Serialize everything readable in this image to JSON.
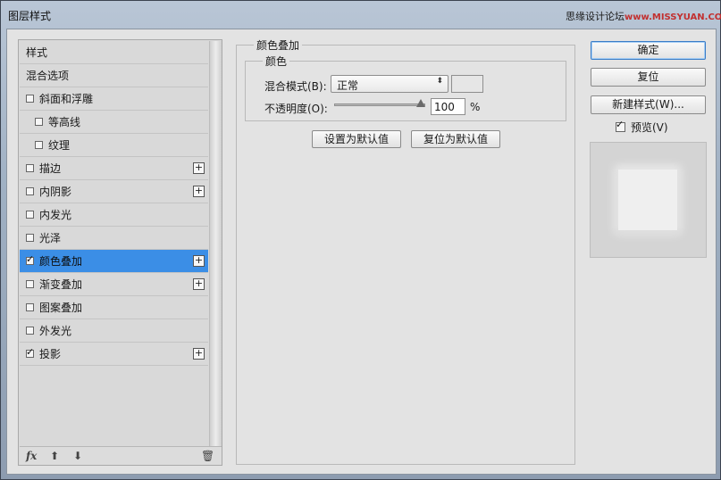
{
  "window": {
    "title": "图层样式",
    "watermark_prefix": "思缘设计论坛",
    "watermark_site": "www.MISSYUAN.COM"
  },
  "styles": {
    "items": [
      {
        "label": "样式",
        "checkbox": false,
        "checked": false,
        "plus": false,
        "indent": false,
        "selected": false
      },
      {
        "label": "混合选项",
        "checkbox": false,
        "checked": false,
        "plus": false,
        "indent": false,
        "selected": false
      },
      {
        "label": "斜面和浮雕",
        "checkbox": true,
        "checked": false,
        "plus": false,
        "indent": false,
        "selected": false
      },
      {
        "label": "等高线",
        "checkbox": true,
        "checked": false,
        "plus": false,
        "indent": true,
        "selected": false
      },
      {
        "label": "纹理",
        "checkbox": true,
        "checked": false,
        "plus": false,
        "indent": true,
        "selected": false
      },
      {
        "label": "描边",
        "checkbox": true,
        "checked": false,
        "plus": true,
        "indent": false,
        "selected": false
      },
      {
        "label": "内阴影",
        "checkbox": true,
        "checked": false,
        "plus": true,
        "indent": false,
        "selected": false
      },
      {
        "label": "内发光",
        "checkbox": true,
        "checked": false,
        "plus": false,
        "indent": false,
        "selected": false
      },
      {
        "label": "光泽",
        "checkbox": true,
        "checked": false,
        "plus": false,
        "indent": false,
        "selected": false
      },
      {
        "label": "颜色叠加",
        "checkbox": true,
        "checked": true,
        "plus": true,
        "indent": false,
        "selected": true
      },
      {
        "label": "渐变叠加",
        "checkbox": true,
        "checked": false,
        "plus": true,
        "indent": false,
        "selected": false
      },
      {
        "label": "图案叠加",
        "checkbox": true,
        "checked": false,
        "plus": false,
        "indent": false,
        "selected": false
      },
      {
        "label": "外发光",
        "checkbox": true,
        "checked": false,
        "plus": false,
        "indent": false,
        "selected": false
      },
      {
        "label": "投影",
        "checkbox": true,
        "checked": true,
        "plus": true,
        "indent": false,
        "selected": false
      }
    ],
    "bottom_icons": [
      "fx-icon",
      "arrow-up-icon",
      "arrow-down-icon",
      "trash-icon"
    ]
  },
  "color_overlay": {
    "group_title": "颜色叠加",
    "sub_title": "颜色",
    "blend_mode_label": "混合模式(B):",
    "blend_mode_value": "正常",
    "opacity_label": "不透明度(O):",
    "opacity_value": "100",
    "opacity_unit": "%",
    "opacity_level": 1.0,
    "set_default_label": "设置为默认值",
    "reset_default_label": "复位为默认值"
  },
  "actions": {
    "ok_label": "确定",
    "reset_label": "复位",
    "new_style_label": "新建样式(W)...",
    "preview_label": "预览(V)",
    "preview_checked": true
  },
  "colors": {
    "selection": "#3b8ee6",
    "dialog_bg": "#e3e3e3"
  }
}
